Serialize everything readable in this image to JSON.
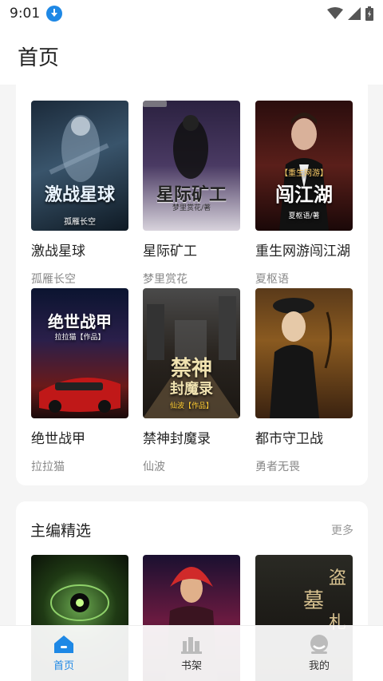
{
  "status": {
    "time": "9:01"
  },
  "header": {
    "title": "首页"
  },
  "grid_books": [
    {
      "title": "激战星球",
      "author": "孤雁长空",
      "cover_text": "激战星球",
      "cover_sub": "孤雁长空"
    },
    {
      "title": "星际矿工",
      "author": "梦里赏花",
      "cover_text": "星际矿工",
      "cover_sub": "梦里赏花/著"
    },
    {
      "title": "重生网游闯江湖",
      "author": "夏枢语",
      "cover_text": "闯江湖",
      "cover_sub": "夏枢语/著",
      "cover_tag": "【重生网游】"
    },
    {
      "title": "绝世战甲",
      "author": "拉拉猫",
      "cover_text": "绝世战甲",
      "cover_sub": "拉拉猫【作品】"
    },
    {
      "title": "禁神封魔录",
      "author": "仙波",
      "cover_text": "禁神封魔录",
      "cover_sub": "仙波【作品】"
    },
    {
      "title": "都市守卫战",
      "author": "勇者无畏",
      "cover_text": "都市守卫战",
      "cover_sub": ""
    }
  ],
  "editor_section": {
    "title": "主编精选",
    "more": "更多"
  },
  "bottom_nav": [
    {
      "label": "首页",
      "icon": "home-icon",
      "active": true
    },
    {
      "label": "书架",
      "icon": "bookshelf-icon",
      "active": false
    },
    {
      "label": "我的",
      "icon": "profile-icon",
      "active": false
    }
  ],
  "colors": {
    "accent": "#1e88e5",
    "background": "#f5f5f5"
  }
}
